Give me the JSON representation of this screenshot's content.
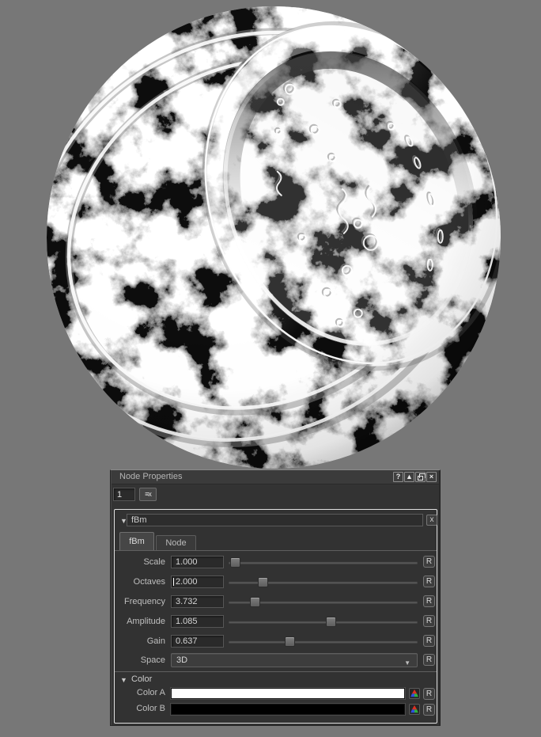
{
  "preview": {
    "background_color": "#777777",
    "sphere_base_color": "#f5f5f5",
    "noise_color": "#0d0d0d"
  },
  "window": {
    "title": "Node Properties",
    "titlebar_buttons": [
      {
        "name": "help",
        "glyph": "?"
      },
      {
        "name": "maximize",
        "glyph": "▲"
      },
      {
        "name": "float",
        "glyph": "❐"
      },
      {
        "name": "close",
        "glyph": "×"
      }
    ],
    "node_number_value": "1",
    "node_picker_glyph": "≡x"
  },
  "node_group": {
    "collapse_glyph": "▼",
    "node_name": "fBm",
    "close_glyph": "x",
    "tabs": [
      {
        "label": "fBm",
        "active": true
      },
      {
        "label": "Node",
        "active": false
      }
    ],
    "reset_button_label": "R",
    "parameters": [
      {
        "label": "Scale",
        "value": "1.000",
        "slider_fraction": 0.01
      },
      {
        "label": "Octaves",
        "value": "2.000",
        "slider_fraction": 0.163,
        "focused": true
      },
      {
        "label": "Frequency",
        "value": "3.732",
        "slider_fraction": 0.118
      },
      {
        "label": "Amplitude",
        "value": "1.085",
        "slider_fraction": 0.546
      },
      {
        "label": "Gain",
        "value": "0.637",
        "slider_fraction": 0.313
      }
    ],
    "space_row": {
      "label": "Space",
      "value": "3D",
      "dropdown_glyph": "▼"
    },
    "color_section": {
      "header": "Color",
      "collapse_glyph": "▼",
      "rows": [
        {
          "label": "Color A",
          "swatch_color": "#ffffff"
        },
        {
          "label": "Color B",
          "swatch_color": "#000000"
        }
      ]
    }
  }
}
